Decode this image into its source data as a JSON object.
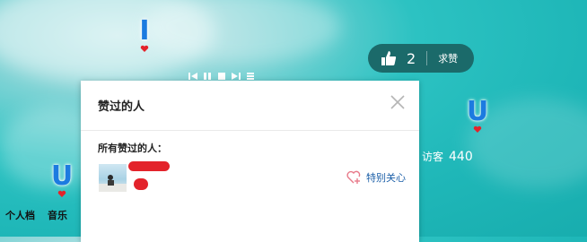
{
  "like_widget": {
    "count": "2",
    "ask_label": "求赞"
  },
  "popup": {
    "title": "赞过的人",
    "subtitle": "所有赞过的人：",
    "special_follow_label": "特别关心"
  },
  "visitors": {
    "label": "访客",
    "count": "440"
  },
  "nav": {
    "items": [
      "个人档",
      "音乐"
    ]
  },
  "colors": {
    "accent": "#1c5fa8",
    "pill_bg": "#1b6a6a",
    "background": "#1fb7b8",
    "redaction": "#e3232b"
  },
  "icons": [
    "thumbs-up-icon",
    "close-icon",
    "heart-plus-icon"
  ]
}
